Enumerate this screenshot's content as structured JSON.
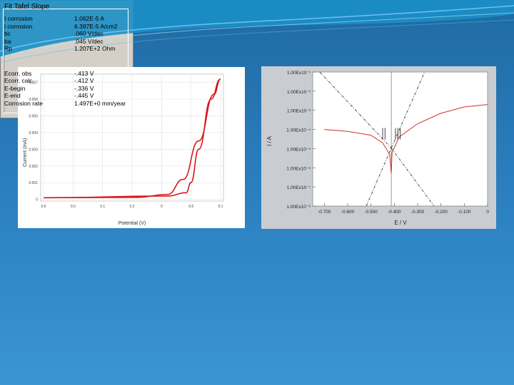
{
  "chart_data": [
    {
      "type": "line",
      "title": "",
      "xlabel": "Potential (V)",
      "ylabel": "Current (mA)",
      "x_ticks": [
        "0.6",
        "0.0",
        "0.1",
        "0.2",
        "0",
        "0.6",
        "0.1"
      ],
      "y_ticks": [
        "0",
        "0.001",
        "0.002",
        "0.003",
        "0.004",
        "0.005",
        "0.006",
        "0.007"
      ],
      "ylim": [
        0,
        0.007
      ],
      "series": [
        {
          "values_forward": [
            [
              -0.6,
              0.0001
            ],
            [
              0.0,
              0.00012
            ],
            [
              0.2,
              0.0003
            ],
            [
              0.3,
              0.0012
            ],
            [
              0.4,
              0.0035
            ],
            [
              0.5,
              0.0063
            ],
            [
              0.54,
              0.0072
            ]
          ]
        },
        {
          "values_reverse": [
            [
              0.54,
              0.0072
            ],
            [
              0.48,
              0.006
            ],
            [
              0.4,
              0.003
            ],
            [
              0.35,
              0.001
            ],
            [
              0.32,
              0.0004
            ],
            [
              0.2,
              0.0002
            ],
            [
              -0.6,
              0.0001
            ]
          ]
        }
      ]
    },
    {
      "type": "line",
      "title": "",
      "xlabel": "E / V",
      "ylabel": "I / A",
      "yscale": "log",
      "x_ticks": [
        "-0.700",
        "-0.600",
        "-0.500",
        "-0.400",
        "-0.300",
        "-0.200",
        "-0.100",
        "0"
      ],
      "y_ticks": [
        "1.00Ex10⁻⁸",
        "1.00Ex10⁻⁷",
        "1.00Ex10⁻⁶",
        "1.00Ex10⁻⁵",
        "1.00Ex10⁻⁴",
        "1.00Ex10⁻³",
        "1.00Ex10⁻²",
        "1.00Ex10⁻¹"
      ],
      "xlim": [
        -0.75,
        0
      ],
      "series": [
        {
          "name": "",
          "color": "#d03028",
          "points": [
            [
              -0.7,
              0.0001
            ],
            [
              -0.6,
              8e-05
            ],
            [
              -0.5,
              5e-05
            ],
            [
              -0.45,
              2e-05
            ],
            [
              -0.42,
              5e-06
            ],
            [
              -0.413,
              5e-07
            ],
            [
              -0.41,
              6e-06
            ],
            [
              -0.38,
              4e-05
            ],
            [
              -0.3,
              0.0002
            ],
            [
              -0.2,
              0.0007
            ],
            [
              -0.1,
              0.0015
            ],
            [
              0,
              0.002
            ]
          ]
        },
        {
          "name": "",
          "color": "#222222",
          "dashed": true,
          "points": [
            [
              -0.72,
              0.1
            ],
            [
              -0.413,
              1.06e-05
            ]
          ]
        },
        {
          "name": "",
          "color": "#222222",
          "dashed": true,
          "points": [
            [
              -0.413,
              1.06e-05
            ],
            [
              -0.27,
              0.1
            ]
          ]
        },
        {
          "name": "",
          "color": "#222222",
          "dashed": true,
          "points": [
            [
              -0.52,
              1e-08
            ],
            [
              -0.413,
              1.06e-05
            ]
          ]
        },
        {
          "name": "",
          "color": "#222222",
          "dashed": true,
          "points": [
            [
              -0.413,
              1.06e-05
            ],
            [
              -0.23,
              1e-08
            ]
          ]
        }
      ]
    }
  ],
  "fit": {
    "title": "Fit Tafel Slope",
    "rows": [
      {
        "label": "I corrosion",
        "value": "1.062E-5  A"
      },
      {
        "label": "i corrosion",
        "value": "6.397E-5  A/cm2"
      },
      {
        "label": "bc",
        "value": ".060 V/dec"
      },
      {
        "label": "ba",
        "value": ".045 V/dec"
      },
      {
        "label": "Rp",
        "value": "1.207E+2 Ohm"
      },
      {
        "label": "Ecorr, obs",
        "value": "-.413  V"
      },
      {
        "label": "Ecorr, calc",
        "value": "-.412 V"
      },
      {
        "label": "E-begin",
        "value": "-.336 V"
      },
      {
        "label": "E-end",
        "value": "-.445 V"
      },
      {
        "label": "Corrosion rate",
        "value": "1.497E+0 mm/year"
      }
    ]
  }
}
